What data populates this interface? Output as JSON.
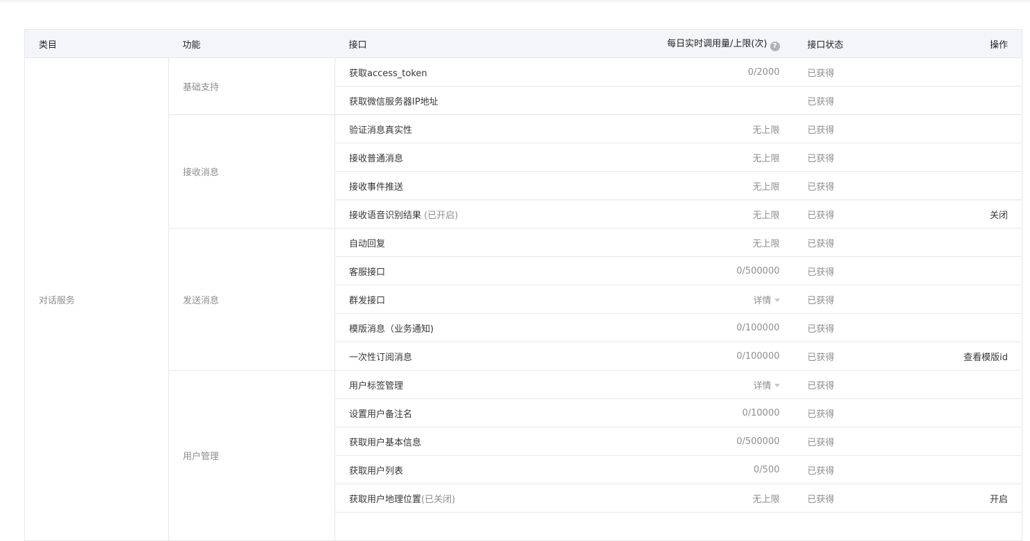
{
  "table": {
    "headers": {
      "category": "类目",
      "function": "功能",
      "api": "接口",
      "limit": "每日实时调用量/上限(次)",
      "status": "接口状态",
      "action": "操作"
    },
    "help_icon": "question-circle-icon",
    "category_name": "对话服务",
    "groups": [
      {
        "function": "基础支持",
        "rows": [
          {
            "api": "获取access_token",
            "note": "",
            "limit": "0/2000",
            "status": "已获得",
            "action": ""
          },
          {
            "api": "获取微信服务器IP地址",
            "note": "",
            "limit": "",
            "status": "已获得",
            "action": ""
          }
        ]
      },
      {
        "function": "接收消息",
        "rows": [
          {
            "api": "验证消息真实性",
            "note": "",
            "limit": "无上限",
            "status": "已获得",
            "action": ""
          },
          {
            "api": "接收普通消息",
            "note": "",
            "limit": "无上限",
            "status": "已获得",
            "action": ""
          },
          {
            "api": "接收事件推送",
            "note": "",
            "limit": "无上限",
            "status": "已获得",
            "action": ""
          },
          {
            "api": "接收语音识别结果",
            "note": " (已开启)",
            "limit": "无上限",
            "status": "已获得",
            "action": "关闭"
          }
        ]
      },
      {
        "function": "发送消息",
        "rows": [
          {
            "api": "自动回复",
            "note": "",
            "limit": "无上限",
            "status": "已获得",
            "action": ""
          },
          {
            "api": "客服接口",
            "note": "",
            "limit": "0/500000",
            "status": "已获得",
            "action": ""
          },
          {
            "api": "群发接口",
            "note": "",
            "limit": "详情",
            "limit_dropdown": true,
            "status": "已获得",
            "action": ""
          },
          {
            "api": "模版消息（业务通知)",
            "note": "",
            "limit": "0/100000",
            "status": "已获得",
            "action": ""
          },
          {
            "api": "一次性订阅消息",
            "note": "",
            "limit": "0/100000",
            "status": "已获得",
            "action": "查看模版id"
          }
        ]
      },
      {
        "function": "用户管理",
        "rows": [
          {
            "api": "用户标签管理",
            "note": "",
            "limit": "详情",
            "limit_dropdown": true,
            "status": "已获得",
            "action": ""
          },
          {
            "api": "设置用户备注名",
            "note": "",
            "limit": "0/10000",
            "status": "已获得",
            "action": ""
          },
          {
            "api": "获取用户基本信息",
            "note": "",
            "limit": "0/500000",
            "status": "已获得",
            "action": ""
          },
          {
            "api": "获取用户列表",
            "note": "",
            "limit": "0/500",
            "status": "已获得",
            "action": ""
          },
          {
            "api": "获取用户地理位置",
            "note": "(已关闭)",
            "limit": "无上限",
            "status": "已获得",
            "action": "开启"
          },
          {
            "api": "",
            "note": "",
            "limit": "",
            "status": "",
            "action": ""
          }
        ]
      }
    ]
  }
}
